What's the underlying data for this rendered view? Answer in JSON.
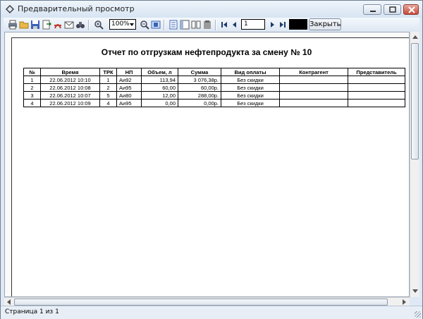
{
  "window": {
    "title": "Предварительный просмотр"
  },
  "toolbar": {
    "zoom_value": "100%",
    "page_value": "1",
    "close_label": "Закрыть"
  },
  "report": {
    "title": "Отчет по отгрузкам нефтепродукта за смену № 10",
    "columns": [
      "№",
      "Время",
      "ТРК",
      "НП",
      "Объем, л",
      "Сумма",
      "Вид оплаты",
      "Контрагент",
      "Представитель"
    ],
    "rows": [
      [
        "1",
        "22.06.2012 10:10",
        "1",
        "Аи92",
        "113,94",
        "3 076,38р.",
        "Без скидки",
        "",
        ""
      ],
      [
        "2",
        "22.06.2012 10:08",
        "2",
        "Аи95",
        "60,00",
        "60,00р.",
        "Без скидки",
        "",
        ""
      ],
      [
        "3",
        "22.06.2012 10:07",
        "5",
        "Аи80",
        "12,00",
        "288,00р.",
        "Без скидки",
        "",
        ""
      ],
      [
        "4",
        "22.06.2012 10:09",
        "4",
        "Аи95",
        "0,00",
        "0,00р.",
        "Без скидки",
        "",
        ""
      ]
    ]
  },
  "status": {
    "text": "Страница 1 из 1"
  },
  "colors": {
    "accent": "#1e5aa8",
    "toolbar_bg": "#dde7f2"
  }
}
